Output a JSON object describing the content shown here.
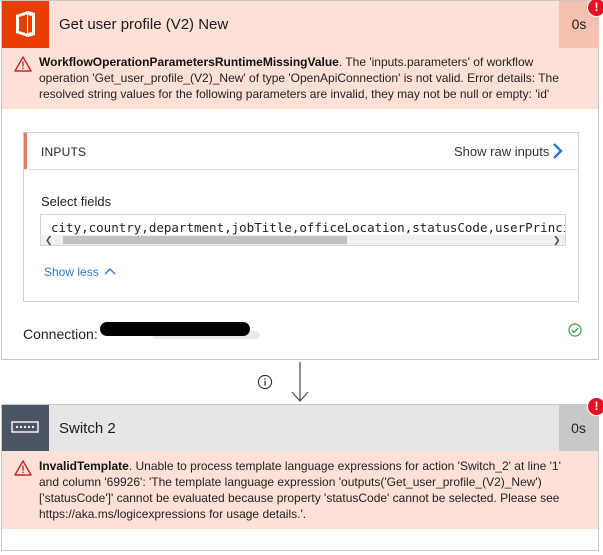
{
  "step1": {
    "title": "Get user profile (V2) New",
    "duration": "0s",
    "icon": "office-icon",
    "error_code": "WorkflowOperationParametersRuntimeMissingValue",
    "error_message": ". The 'inputs.parameters' of workflow operation 'Get_user_profile_(V2)_New' of type 'OpenApiConnection' is not valid. Error details: The resolved string values for the following parameters are invalid, they may not be null or empty: 'id'",
    "inputs_label": "INPUTS",
    "show_raw_inputs": "Show raw inputs",
    "select_fields_label": "Select fields",
    "select_fields_value": "city,country,department,jobTitle,officeLocation,statusCode,userPrincipalName",
    "show_less": "Show less",
    "connection_label": "Connection:",
    "badge": "!"
  },
  "step2": {
    "title": "Switch 2",
    "duration": "0s",
    "icon": "switch-icon",
    "error_code": "InvalidTemplate",
    "error_message": ". Unable to process template language expressions for action 'Switch_2' at line '1' and column '69926': 'The template language expression 'outputs('Get_user_profile_(V2)_New')['statusCode']' cannot be evaluated because property 'statusCode' cannot be selected. Please see https://aka.ms/logicexpressions for usage details.'.",
    "badge": "!"
  },
  "colors": {
    "error_bg": "#fde0d6",
    "office_red": "#eb3c00",
    "badge_red": "#e81123",
    "link_blue": "#2b79d0",
    "success_green": "#3a9b48"
  }
}
